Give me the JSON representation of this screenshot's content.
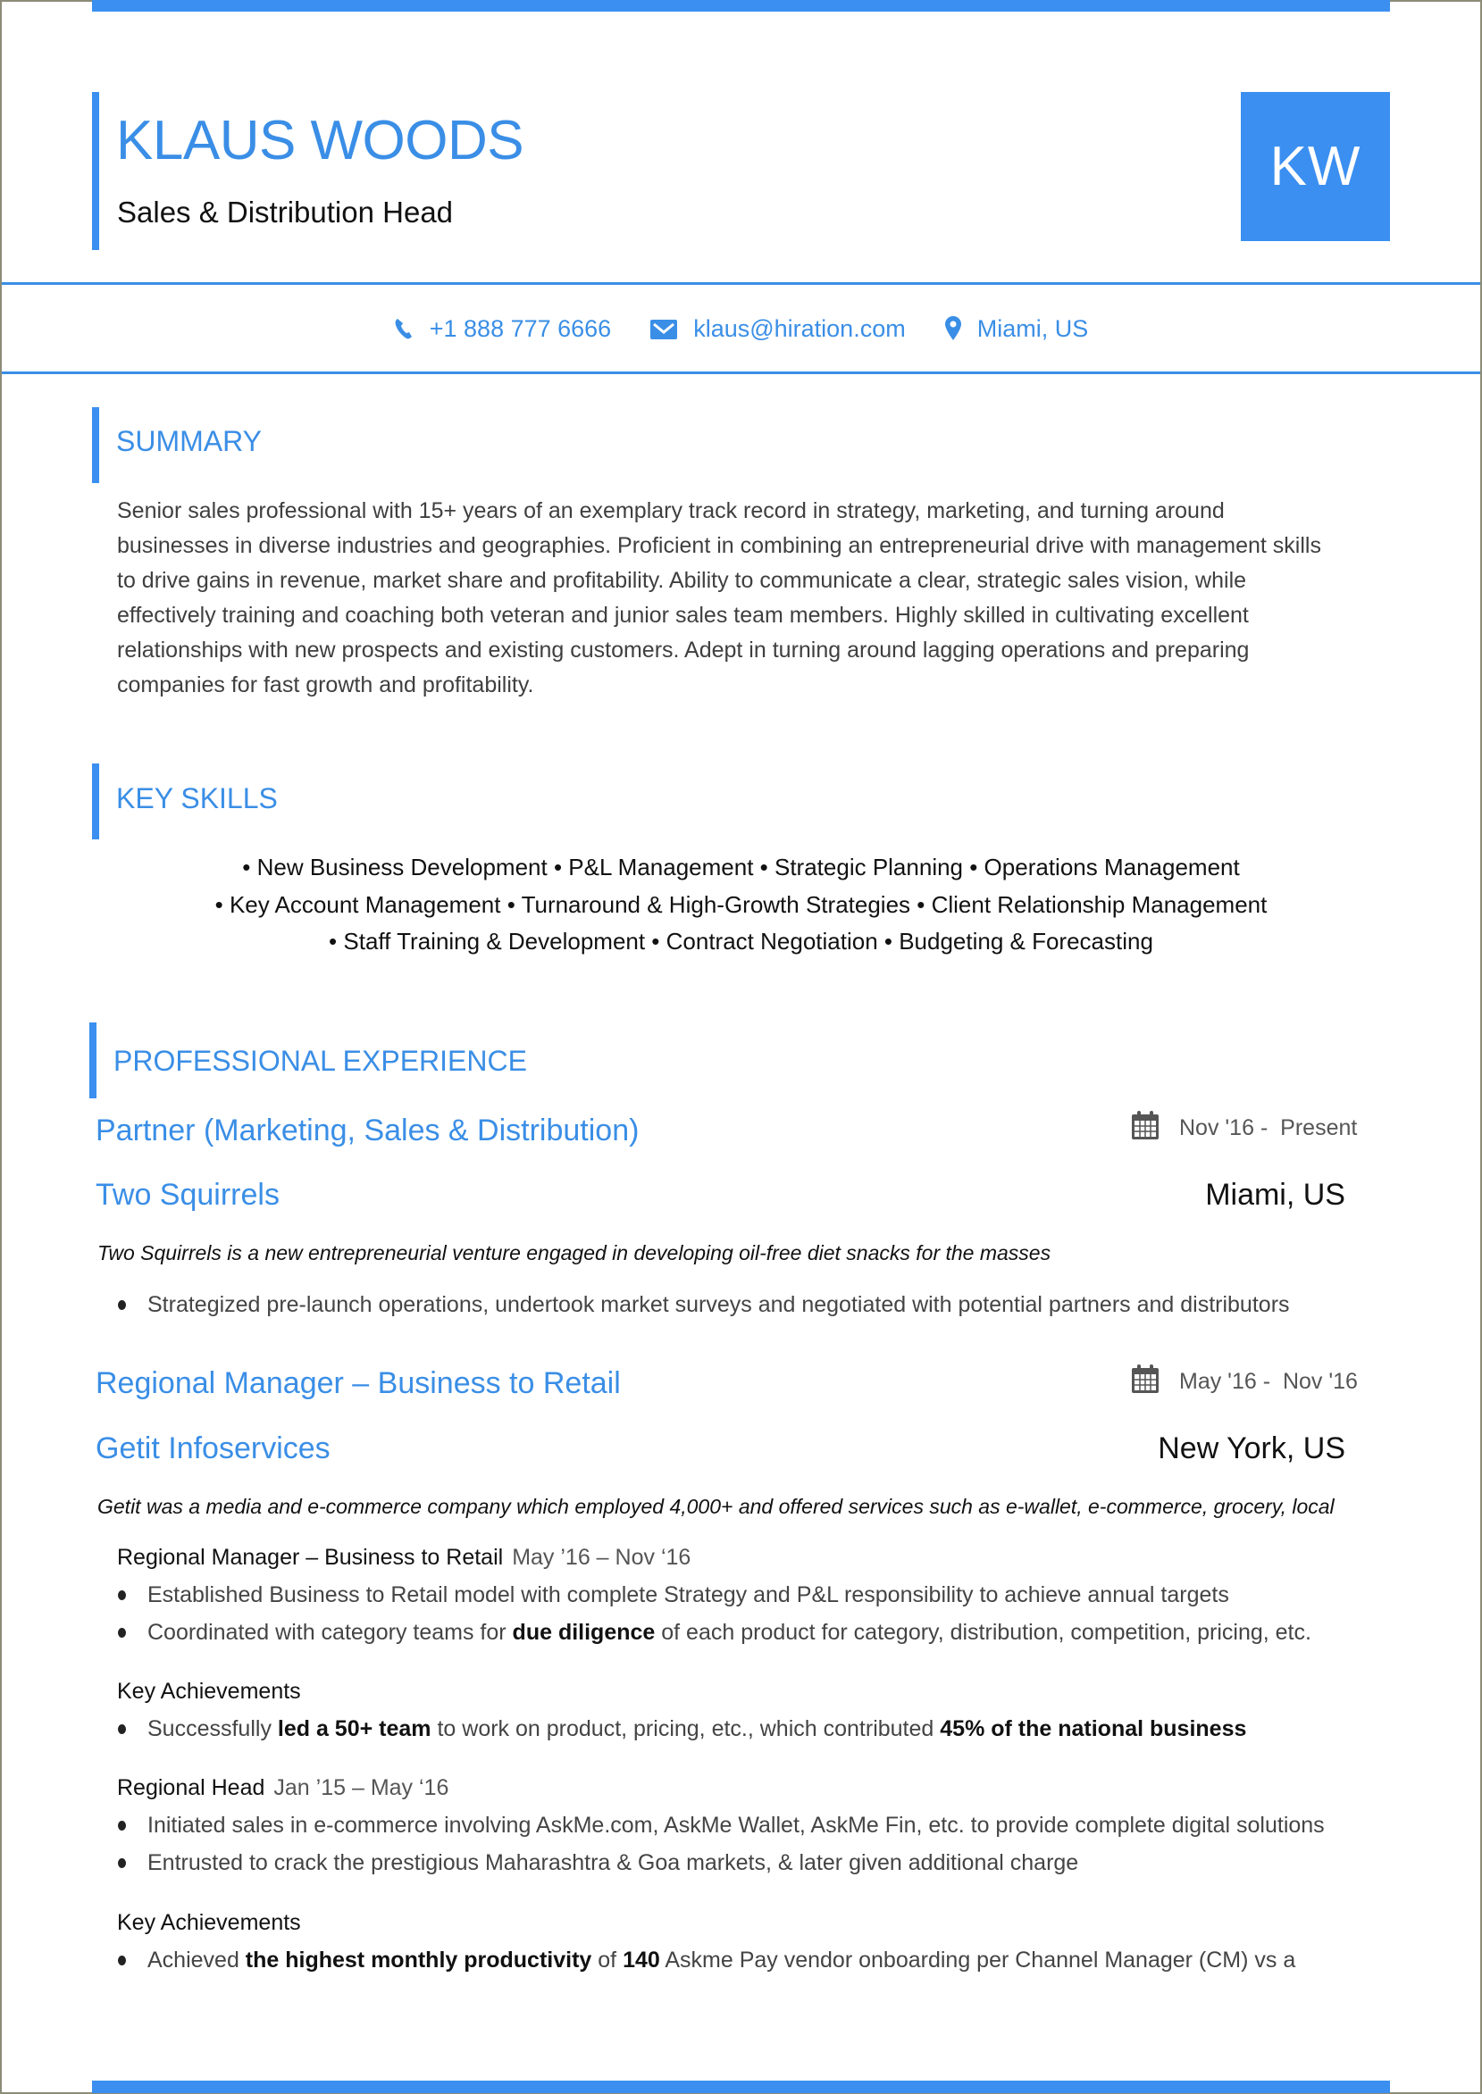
{
  "header": {
    "name": "KLAUS WOODS",
    "title": "Sales & Distribution Head",
    "monogram": "KW",
    "accent_color": "#3a8ff0"
  },
  "contact": {
    "phone": {
      "icon": "phone-icon",
      "text": "+1 888 777 6666"
    },
    "email": {
      "icon": "envelope-icon",
      "text": "klaus@hiration.com"
    },
    "location": {
      "icon": "map-pin-icon",
      "text": "Miami, US"
    }
  },
  "summary": {
    "heading": "SUMMARY",
    "lines": [
      "Senior sales professional with 15+ years of an exemplary track record in strategy, marketing, and turning around",
      "businesses in diverse industries and geographies. Proficient in combining an entrepreneurial drive with management skills",
      "to drive gains in revenue, market share and profitability. Ability to communicate a clear, strategic sales vision, while",
      "effectively training and coaching both veteran and junior sales team members. Highly skilled in cultivating excellent",
      "relationships with new prospects and existing customers. Adept in turning around lagging operations and preparing",
      "companies for fast growth and profitability."
    ]
  },
  "skills": {
    "heading": "KEY SKILLS",
    "lines": [
      "• New Business Development • P&L Management • Strategic Planning • Operations Management",
      "• Key Account Management • Turnaround & High-Growth Strategies • Client Relationship Management",
      "• Staff Training & Development • Contract Negotiation • Budgeting & Forecasting"
    ]
  },
  "experience": {
    "heading": "PROFESSIONAL EXPERIENCE",
    "jobs": [
      {
        "title": "Partner (Marketing, Sales & Distribution)",
        "date_start": "Nov '16",
        "date_sep": "-",
        "date_end": "Present",
        "company": "Two Squirrels",
        "location": "Miami, US",
        "description": "Two Squirrels is a new entrepreneurial venture engaged in developing oil-free diet snacks for the masses",
        "bullets": [
          "Strategized pre-launch operations, undertook market surveys and negotiated with potential partners and distributors"
        ]
      },
      {
        "title": "Regional Manager – Business to Retail",
        "date_start": "May '16",
        "date_sep": "-",
        "date_end": "Nov '16",
        "company": "Getit Infoservices",
        "location": "New York, US",
        "description": "Getit was a media and e-commerce company which employed 4,000+  and offered services such as e-wallet, e-commerce, grocery, local",
        "roles": [
          {
            "role": "Regional Manager – Business to Retail",
            "dates": "May ’16 – Nov ‘16",
            "bullets": [
              [
                {
                  "t": "Established Business to Retail model with complete Strategy and P&L responsibility to achieve annual targets"
                }
              ],
              [
                {
                  "t": "Coordinated with category teams for "
                },
                {
                  "t": "due diligence",
                  "b": true
                },
                {
                  "t": " of each product for category, distribution, competition, pricing, etc."
                }
              ]
            ],
            "achievements_heading": "Key Achievements",
            "achievements": [
              [
                {
                  "t": "Successfully "
                },
                {
                  "t": "led a 50+ team",
                  "b": true
                },
                {
                  "t": " to work on product, pricing, etc., which contributed "
                },
                {
                  "t": "45% of the national business",
                  "b": true
                }
              ]
            ]
          },
          {
            "role": "Regional Head",
            "dates": "Jan ’15 – May ‘16",
            "bullets": [
              [
                {
                  "t": "Initiated sales in e-commerce involving AskMe.com, AskMe Wallet, AskMe Fin, etc. to provide complete digital solutions"
                }
              ],
              [
                {
                  "t": "Entrusted to crack the prestigious Maharashtra & Goa markets, & later given additional charge"
                }
              ]
            ],
            "achievements_heading": "Key Achievements",
            "achievements": [
              [
                {
                  "t": "Achieved "
                },
                {
                  "t": "the highest monthly productivity",
                  "b": true
                },
                {
                  "t": " of "
                },
                {
                  "t": "140",
                  "b": true
                },
                {
                  "t": " Askme Pay vendor onboarding per Channel Manager (CM) vs a"
                }
              ]
            ]
          }
        ]
      }
    ]
  }
}
